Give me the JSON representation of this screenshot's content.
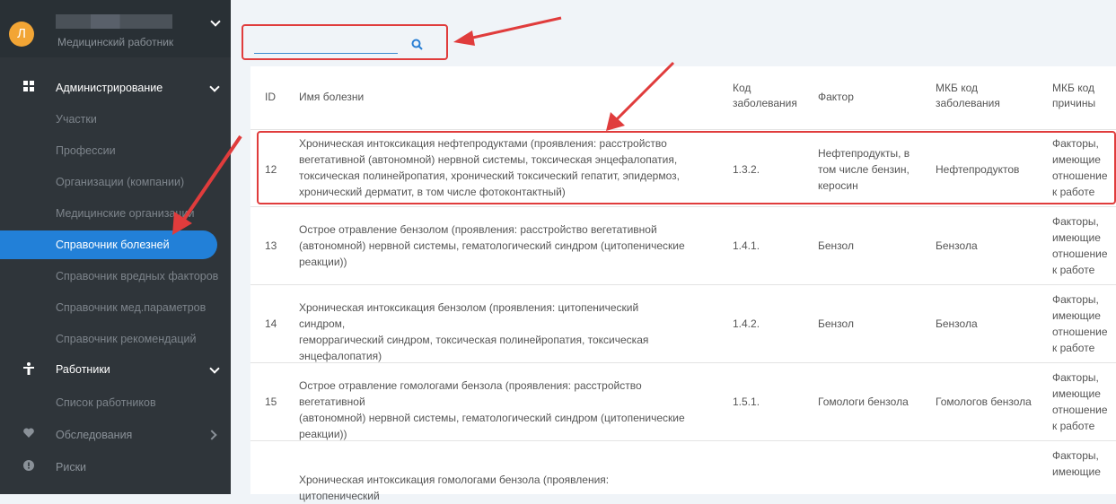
{
  "profile": {
    "avatar_letter": "Л",
    "role": "Медицинский работник"
  },
  "sidebar": {
    "groups": [
      {
        "label": "Администрирование",
        "icon": "grid-icon"
      },
      {
        "label": "Работники",
        "icon": "person-icon"
      },
      {
        "label": "Обследования",
        "icon": "heart-icon"
      },
      {
        "label": "Риски",
        "icon": "alert-icon"
      }
    ],
    "admin_items": [
      "Участки",
      "Профессии",
      "Организации (компании)",
      "Медицинские организации",
      "Справочник болезней",
      "Справочник вредных факторов",
      "Справочник мед.параметров",
      "Справочник рекомендаций"
    ],
    "worker_items": [
      "Список работников"
    ],
    "active_item": "Справочник болезней"
  },
  "search": {
    "value": "",
    "placeholder": ""
  },
  "table": {
    "headers": {
      "id": "ID",
      "name": "Имя болезни",
      "code_1": "Код",
      "code_2": "заболевания",
      "factor": "Фактор",
      "mkb_1": "МКБ код",
      "mkb_2": "заболевания",
      "cause_1": "МКБ код",
      "cause_2": "причины"
    },
    "rows": [
      {
        "id": "12",
        "name": [
          "Хроническая интоксикация нефтепродуктами (проявления: расстройство",
          "вегетативной (автономной) нервной системы, токсическая энцефалопатия,",
          "токсическая полинейропатия, хронический токсический гепатит, эпидермоз,",
          "хронический дерматит, в том числе фотоконтактный)"
        ],
        "code": "1.3.2.",
        "factor": [
          "Нефтепродукты, в",
          "том числе бензин,",
          "керосин"
        ],
        "mkb": "Нефтепродуктов",
        "cause": [
          "Факторы,",
          "имеющие",
          "отношение",
          "к работе"
        ]
      },
      {
        "id": "13",
        "name": [
          "Острое отравление бензолом (проявления: расстройство вегетативной",
          "(автономной) нервной системы, гематологический синдром (цитопенические",
          "реакции))"
        ],
        "code": "1.4.1.",
        "factor": [
          "Бензол"
        ],
        "mkb": "Бензола",
        "cause": [
          "Факторы,",
          "имеющие",
          "отношение",
          "к работе"
        ]
      },
      {
        "id": "14",
        "name": [
          "Хроническая интоксикация бензолом (проявления: цитопенический синдром,",
          "геморрагический синдром, токсическая полинейропатия, токсическая",
          "энцефалопатия)"
        ],
        "code": "1.4.2.",
        "factor": [
          "Бензол"
        ],
        "mkb": "Бензола",
        "cause": [
          "Факторы,",
          "имеющие",
          "отношение",
          "к работе"
        ]
      },
      {
        "id": "15",
        "name": [
          "Острое отравление гомологами бензола (проявления: расстройство вегетативной",
          "(автономной) нервной системы, гематологический синдром (цитопенические",
          "реакции))"
        ],
        "code": "1.5.1.",
        "factor": [
          "Гомологи бензола"
        ],
        "mkb": "Гомологов бензола",
        "cause": [
          "Факторы,",
          "имеющие",
          "отношение",
          "к работе"
        ]
      },
      {
        "id": "",
        "name": [
          "Хроническая интоксикация гомологами бензола (проявления: цитопенический"
        ],
        "code": "",
        "factor": [
          ""
        ],
        "mkb": "",
        "cause": [
          "Факторы,",
          "имеющие"
        ]
      }
    ]
  },
  "colors": {
    "sidebar_bg": "#2f353a",
    "active_item": "#2280d8",
    "annotation_red": "#e03c3c",
    "avatar": "#f2a535"
  }
}
